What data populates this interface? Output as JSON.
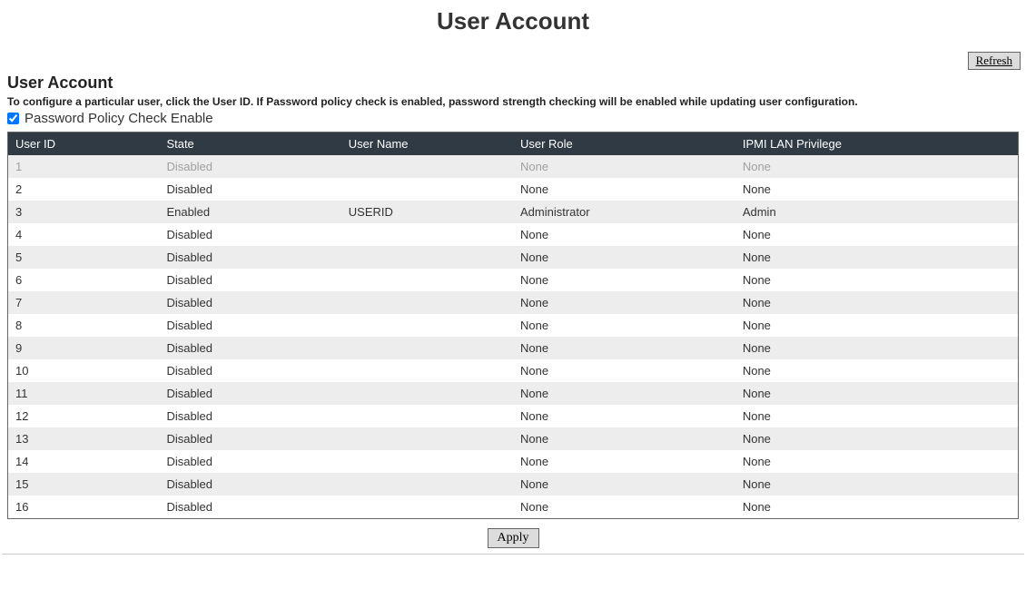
{
  "page_title": "User Account",
  "refresh_label": "Refresh",
  "section_title": "User Account",
  "section_desc": "To configure a particular user, click the User ID. If Password policy check is enabled, password strength checking will be enabled while updating user configuration.",
  "checkbox_label": "Password Policy Check Enable",
  "checkbox_checked": true,
  "columns": {
    "user_id": "User ID",
    "state": "State",
    "user_name": "User Name",
    "user_role": "User Role",
    "ipmi_priv": "IPMI LAN Privilege"
  },
  "rows": [
    {
      "id": "1",
      "state": "Disabled",
      "name": "",
      "role": "None",
      "priv": "None",
      "muted": true
    },
    {
      "id": "2",
      "state": "Disabled",
      "name": "",
      "role": "None",
      "priv": "None",
      "muted": false
    },
    {
      "id": "3",
      "state": "Enabled",
      "name": "USERID",
      "role": "Administrator",
      "priv": "Admin",
      "muted": false
    },
    {
      "id": "4",
      "state": "Disabled",
      "name": "",
      "role": "None",
      "priv": "None",
      "muted": false
    },
    {
      "id": "5",
      "state": "Disabled",
      "name": "",
      "role": "None",
      "priv": "None",
      "muted": false
    },
    {
      "id": "6",
      "state": "Disabled",
      "name": "",
      "role": "None",
      "priv": "None",
      "muted": false
    },
    {
      "id": "7",
      "state": "Disabled",
      "name": "",
      "role": "None",
      "priv": "None",
      "muted": false
    },
    {
      "id": "8",
      "state": "Disabled",
      "name": "",
      "role": "None",
      "priv": "None",
      "muted": false
    },
    {
      "id": "9",
      "state": "Disabled",
      "name": "",
      "role": "None",
      "priv": "None",
      "muted": false
    },
    {
      "id": "10",
      "state": "Disabled",
      "name": "",
      "role": "None",
      "priv": "None",
      "muted": false
    },
    {
      "id": "11",
      "state": "Disabled",
      "name": "",
      "role": "None",
      "priv": "None",
      "muted": false
    },
    {
      "id": "12",
      "state": "Disabled",
      "name": "",
      "role": "None",
      "priv": "None",
      "muted": false
    },
    {
      "id": "13",
      "state": "Disabled",
      "name": "",
      "role": "None",
      "priv": "None",
      "muted": false
    },
    {
      "id": "14",
      "state": "Disabled",
      "name": "",
      "role": "None",
      "priv": "None",
      "muted": false
    },
    {
      "id": "15",
      "state": "Disabled",
      "name": "",
      "role": "None",
      "priv": "None",
      "muted": false
    },
    {
      "id": "16",
      "state": "Disabled",
      "name": "",
      "role": "None",
      "priv": "None",
      "muted": false
    }
  ],
  "apply_label": "Apply"
}
